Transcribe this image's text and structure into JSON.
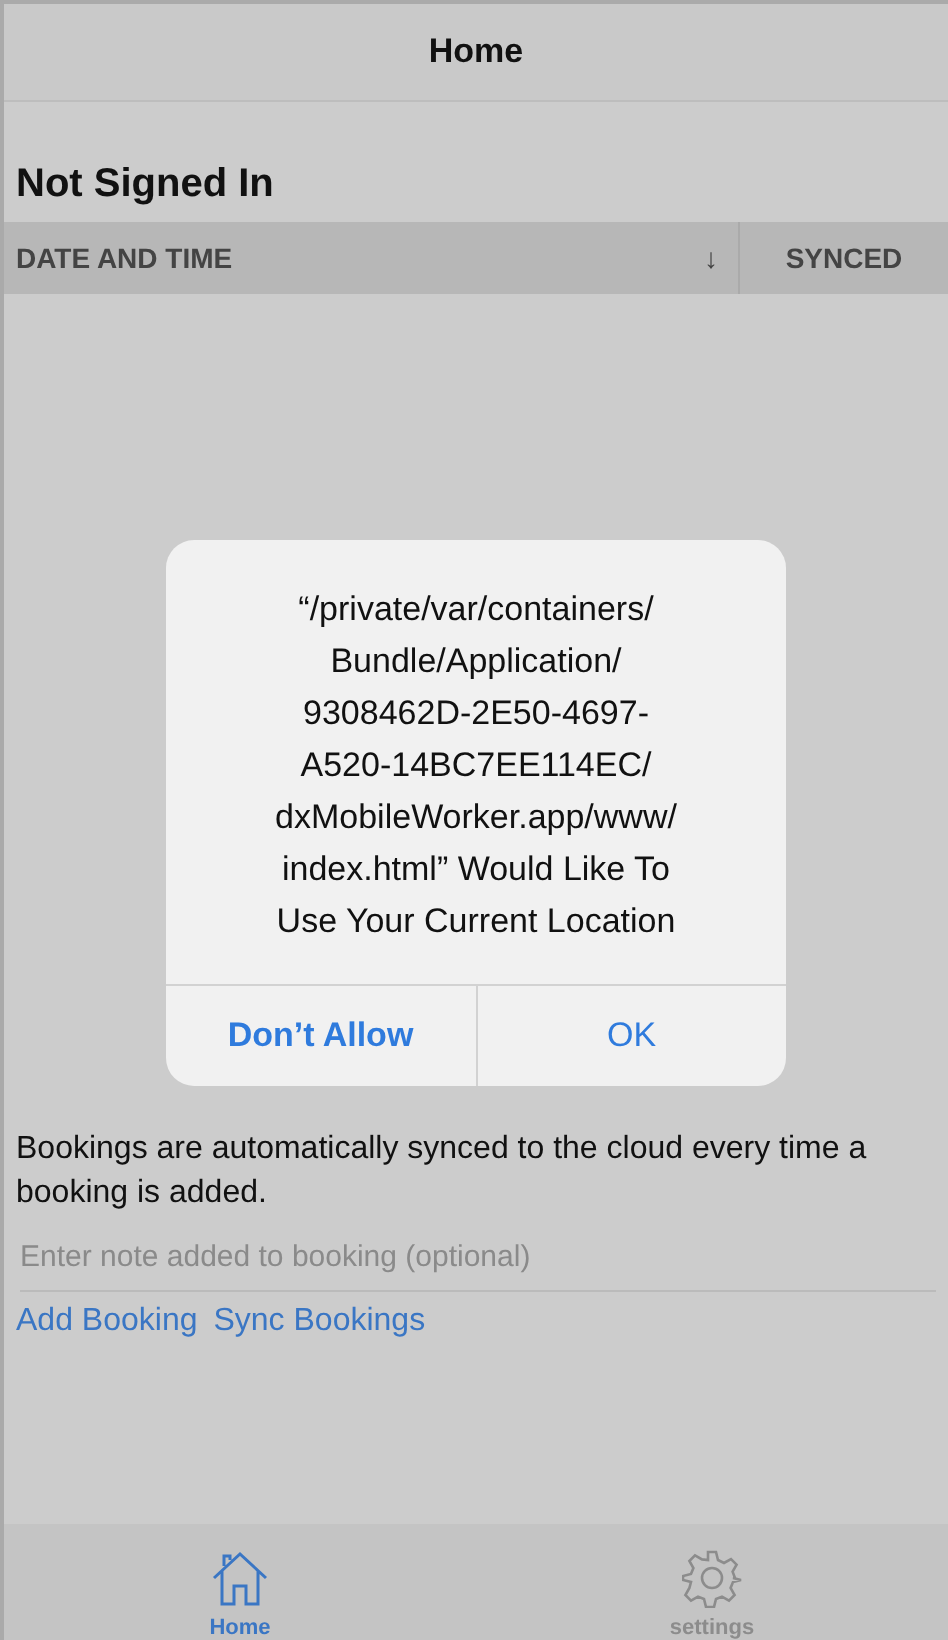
{
  "nav_bar": {
    "title": "Home"
  },
  "heading": "Not Signed In",
  "table": {
    "columns": [
      {
        "label": "DATE AND TIME",
        "sort_icon": "↓"
      },
      {
        "label": "SYNCED"
      }
    ]
  },
  "alert": {
    "message": "“/private/var/containers/\nBundle/Application/\n9308462D-2E50-4697-\nA520-14BC7EE114EC/\ndxMobileWorker.app/www/\nindex.html” Would Like To\nUse Your Current Location",
    "buttons": [
      {
        "label": "Don’t Allow",
        "bold": true
      },
      {
        "label": "OK",
        "bold": false
      }
    ]
  },
  "info_text": "Bookings are automatically synced to the cloud every time a booking is added.",
  "note_field": {
    "placeholder": "Enter note added to booking (optional)"
  },
  "links": [
    "Add Booking",
    "Sync Bookings"
  ],
  "tab_bar": [
    {
      "label": "Home",
      "kind": "home",
      "selected": true
    },
    {
      "label": "settings",
      "kind": "settings",
      "selected": false
    }
  ]
}
